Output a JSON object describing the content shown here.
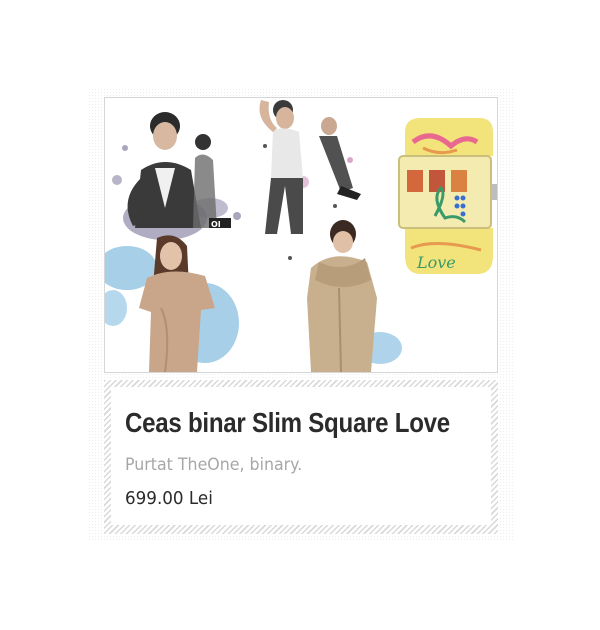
{
  "product": {
    "title": "Ceas binar Slim Square Love",
    "subtitle": "Purtat TheOne, binary.",
    "price": "699.00 Lei",
    "watch_brand_mark": "OI",
    "watch_script_text": "Love"
  },
  "colors": {
    "title": "#2b2b2b",
    "subtitle": "#a7a7a7",
    "price": "#2b2b2b",
    "frame_border": "#d6d6d6",
    "watch_strap": "#f2e37a",
    "paint_blue": "#5ea8d6",
    "paint_purple": "#6f6a92"
  }
}
